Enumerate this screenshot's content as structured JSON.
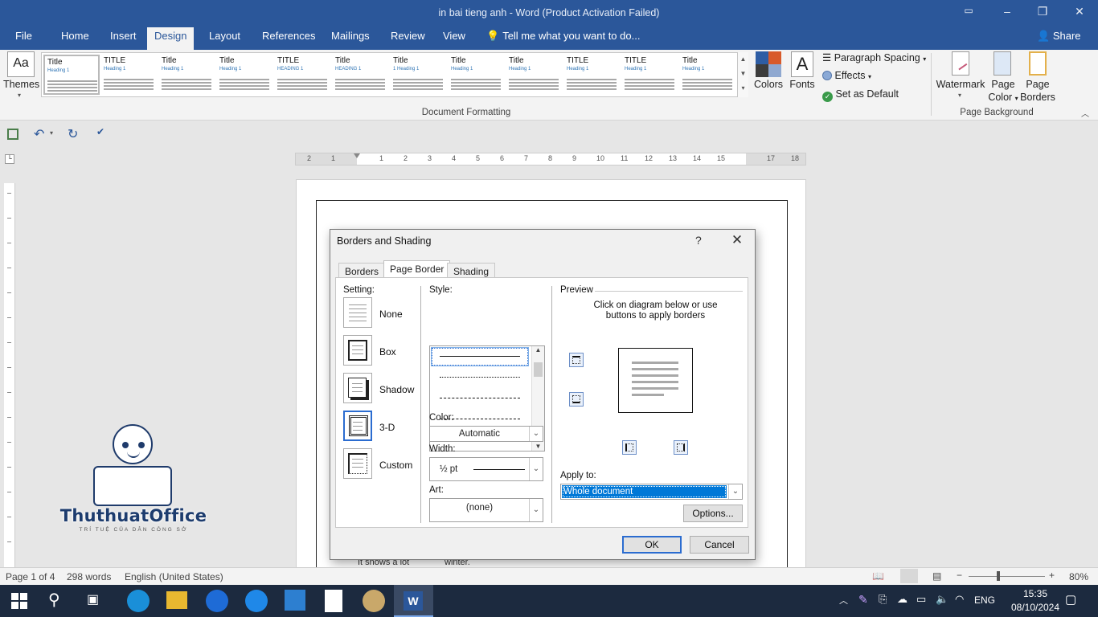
{
  "window": {
    "title": "in bai tieng anh - Word (Product Activation Failed)",
    "controls": {
      "restore_icon": "ribbon-display-icon",
      "minimize": "–",
      "maximize": "❐",
      "close": "✕"
    }
  },
  "ribbon_tabs": [
    {
      "label": "File"
    },
    {
      "label": "Home"
    },
    {
      "label": "Insert"
    },
    {
      "label": "Design",
      "active": true
    },
    {
      "label": "Layout"
    },
    {
      "label": "References"
    },
    {
      "label": "Mailings"
    },
    {
      "label": "Review"
    },
    {
      "label": "View"
    }
  ],
  "tell_me": "Tell me what you want to do...",
  "share": "Share",
  "ribbon": {
    "themes_label": "Themes",
    "themes_glyph": "Aa",
    "gallery": [
      {
        "title": "Title",
        "heading": "Heading 1"
      },
      {
        "title": "TITLE",
        "heading": "Heading 1"
      },
      {
        "title": "Title",
        "heading": "Heading 1"
      },
      {
        "title": "Title",
        "heading": "Heading 1"
      },
      {
        "title": "TITLE",
        "heading": "HEADING 1"
      },
      {
        "title": "Title",
        "heading": "HEADING 1"
      },
      {
        "title": "Title",
        "heading": "1 Heading 1"
      },
      {
        "title": "Title",
        "heading": "Heading 1"
      },
      {
        "title": "Title",
        "heading": "Heading 1"
      },
      {
        "title": "TITLE",
        "heading": "Heading 1"
      },
      {
        "title": "TITLE",
        "heading": "Heading 1"
      },
      {
        "title": "Title",
        "heading": "Heading 1"
      }
    ],
    "colors_label": "Colors",
    "fonts_label": "Fonts",
    "fonts_glyph": "A",
    "paragraph_spacing": "Paragraph Spacing",
    "effects": "Effects",
    "set_as_default": "Set as Default",
    "document_formatting": "Document Formatting",
    "watermark": "Watermark",
    "page_color_1": "Page",
    "page_color_2": "Color",
    "page_borders_1": "Page",
    "page_borders_2": "Borders",
    "page_background": "Page Background"
  },
  "ruler_numbers": [
    "2",
    "1",
    "1",
    "2",
    "3",
    "4",
    "5",
    "6",
    "7",
    "8",
    "9",
    "10",
    "11",
    "12",
    "13",
    "14",
    "15",
    "17",
    "18"
  ],
  "document": {
    "line1": "It snows a lot",
    "line2": "winter."
  },
  "dialog": {
    "title": "Borders and Shading",
    "help": "?",
    "tabs": [
      {
        "label": "Borders",
        "underline": "B"
      },
      {
        "label": "Page Border",
        "underline": "P",
        "active": true
      },
      {
        "label": "Shading",
        "underline": "S"
      }
    ],
    "setting_label": "Setting:",
    "settings": [
      {
        "label": "None"
      },
      {
        "label": "Box"
      },
      {
        "label": "Shadow"
      },
      {
        "label": "3-D",
        "selected": true
      },
      {
        "label": "Custom"
      }
    ],
    "style_label": "Style:",
    "color_label": "Color:",
    "color_value": "Automatic",
    "width_label": "Width:",
    "width_value": "½ pt",
    "art_label": "Art:",
    "art_value": "(none)",
    "preview_label": "Preview",
    "preview_hint": "Click on diagram below or use buttons to apply borders",
    "apply_to_label": "Apply to:",
    "apply_to_value": "Whole document",
    "options": "Options...",
    "ok": "OK",
    "cancel": "Cancel"
  },
  "status": {
    "page": "Page 1 of 4",
    "words": "298 words",
    "language": "English (United States)",
    "zoom": "80%"
  },
  "watermark_logo": {
    "name": "ThuthuatOffice",
    "tagline": "TRÍ TUỆ CỦA DÂN CÔNG SỞ"
  },
  "taskbar": {
    "language": "ENG",
    "time": "15:35",
    "date": "08/10/2024"
  },
  "colors": {
    "word_blue": "#2b579a",
    "selection_blue": "#0078d7"
  }
}
